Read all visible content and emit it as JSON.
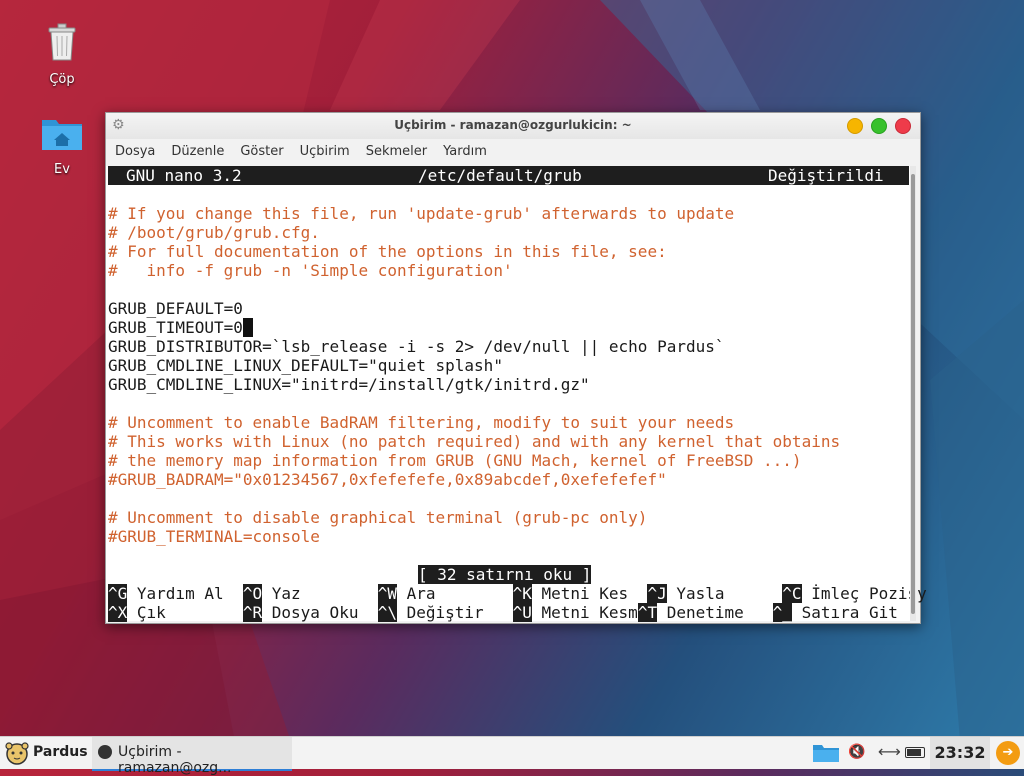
{
  "desktop": {
    "icons": [
      {
        "label": "Çöp",
        "icon": "trash-icon"
      },
      {
        "label": "Ev",
        "icon": "home-folder-icon"
      }
    ]
  },
  "window": {
    "title": "Uçbirim - ramazan@ozgurlukicin: ~",
    "menu": [
      "Dosya",
      "Düzenle",
      "Göster",
      "Uçbirim",
      "Sekmeler",
      "Yardım"
    ]
  },
  "nano": {
    "version": "GNU nano 3.2",
    "file": "/etc/default/grub",
    "state": "Değiştirildi",
    "lines": [
      {
        "text": "",
        "comment": false
      },
      {
        "text": "# If you change this file, run 'update-grub' afterwards to update",
        "comment": true
      },
      {
        "text": "# /boot/grub/grub.cfg.",
        "comment": true
      },
      {
        "text": "# For full documentation of the options in this file, see:",
        "comment": true
      },
      {
        "text": "#   info -f grub -n 'Simple configuration'",
        "comment": true
      },
      {
        "text": "",
        "comment": false
      },
      {
        "text": "GRUB_DEFAULT=0",
        "comment": false
      },
      {
        "text": "GRUB_TIMEOUT=0",
        "comment": false
      },
      {
        "text": "GRUB_DISTRIBUTOR=`lsb_release -i -s 2> /dev/null || echo Pardus`",
        "comment": false
      },
      {
        "text": "GRUB_CMDLINE_LINUX_DEFAULT=\"quiet splash\"",
        "comment": false
      },
      {
        "text": "GRUB_CMDLINE_LINUX=\"initrd=/install/gtk/initrd.gz\"",
        "comment": false
      },
      {
        "text": "",
        "comment": false
      },
      {
        "text": "# Uncomment to enable BadRAM filtering, modify to suit your needs",
        "comment": true
      },
      {
        "text": "# This works with Linux (no patch required) and with any kernel that obtains",
        "comment": true
      },
      {
        "text": "# the memory map information from GRUB (GNU Mach, kernel of FreeBSD ...)",
        "comment": true
      },
      {
        "text": "#GRUB_BADRAM=\"0x01234567,0xfefefefe,0x89abcdef,0xefefefef\"",
        "comment": true
      },
      {
        "text": "",
        "comment": false
      },
      {
        "text": "# Uncomment to disable graphical terminal (grub-pc only)",
        "comment": true
      },
      {
        "text": "#GRUB_TERMINAL=console",
        "comment": true
      }
    ],
    "status": "[ 32 satırnı oku ]",
    "shortcuts_row1": [
      {
        "key": "^G",
        "label": " Yardım Al  "
      },
      {
        "key": "^O",
        "label": " Yaz        "
      },
      {
        "key": "^W",
        "label": " Ara        "
      },
      {
        "key": "^K",
        "label": " Metni Kes  "
      },
      {
        "key": "^J",
        "label": " Yasla      "
      },
      {
        "key": "^C",
        "label": " İmleç Pozisy"
      }
    ],
    "shortcuts_row2": [
      {
        "key": "^X",
        "label": " Çık        "
      },
      {
        "key": "^R",
        "label": " Dosya Oku  "
      },
      {
        "key": "^\\",
        "label": " Değiştir   "
      },
      {
        "key": "^U",
        "label": " Metni Kesm"
      },
      {
        "key": "^T",
        "label": " Denetime   "
      },
      {
        "key": "^_",
        "label": " Satıra Git"
      }
    ]
  },
  "taskbar": {
    "menu_label": "Pardus",
    "task_label": "Uçbirim - ramazan@ozg...",
    "clock": "23:32"
  }
}
